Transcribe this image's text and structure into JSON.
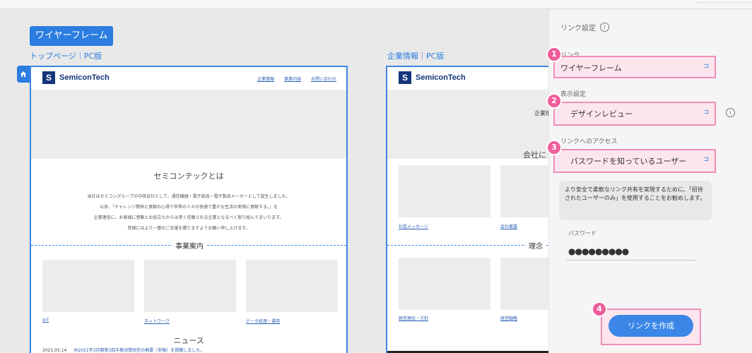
{
  "canvas": {
    "project_name": "ワイヤーフレーム",
    "pages": [
      {
        "label": "トップページ｜PC版",
        "logo_text": "SemiconTech",
        "logo_mark": "S",
        "nav": [
          "企業情報",
          "事業内容",
          "お問い合わせ"
        ],
        "section_title": "セミコンテックとは",
        "body_lines": [
          "当社はセミコングループの中核会社として、通信機器・電子部品・電子製品メーカーとして誕生しました。",
          "以来、「チャレンジ精神と貢献の心得で世界の人々の快適で豊かな生活の実現に貢献する。」を",
          "企業理念に、お客様に感動とお役立ちからは常く信頼される企業となるべく取り組んでまいります。",
          "皆様にはより一層のご支援を賜りますようお願い申し上げます。"
        ],
        "divider_label": "事業案内",
        "thumb_captions": [
          "IoT",
          "ネットワーク",
          "データ処理・運用"
        ],
        "news_title": "ニュース",
        "news_date": "2021.05.14",
        "news_text": "IR2021年3月期第3四半期決算短信の概要（非報）を掲載しました。"
      },
      {
        "label": "企業情報｜PC版",
        "logo_text": "SemiconTech",
        "logo_mark": "S",
        "hero_text": "企業情",
        "section_title": "会社に",
        "thumb_captions": [
          "社長メッセージ",
          "会社概要",
          "経営理念・方針",
          "経営戦略"
        ],
        "divider_label": "理念"
      }
    ]
  },
  "panel": {
    "title": "リンク設定",
    "link_label": "リンク",
    "link_value": "ワイヤーフレーム",
    "display_label": "表示設定",
    "display_value": "デザインレビュー",
    "access_label": "リンクへのアクセス",
    "access_value": "パスワードを知っているユーザー",
    "note": "より安全で柔軟なリンク共有を実現するために、「招待されたユーザーのみ」を使用することをお勧めします。",
    "password_label": "パスワード",
    "password_value": "●●●●●●●●●",
    "create_button": "リンクを作成",
    "callouts": [
      "1",
      "2",
      "3",
      "4"
    ]
  },
  "colors": {
    "accent": "#2b7de0",
    "highlight_border": "#f08dbb",
    "highlight_fill": "#fde5ee",
    "callout": "#ef5d9a",
    "logo": "#15357a"
  },
  "icons": {
    "home": "home-icon",
    "info": "info-icon",
    "dropdown": "chevron-icon"
  }
}
